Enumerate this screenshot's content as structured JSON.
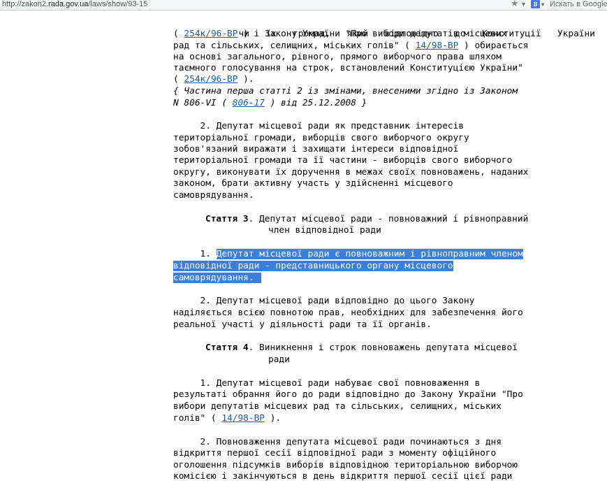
{
  "browser": {
    "url_prefix": "http://zakon2.",
    "url_host": "rada.gov.ua",
    "url_path": "/laws/show/93-15",
    "star_glyph": "★",
    "dropdown_glyph": "▼",
    "search_engine_badge": "8",
    "search_placeholder": "Искать в Google"
  },
  "doc": {
    "l1": [
      "чи",
      "їх",
      "громад,",
      "який",
      "відповідно",
      "до",
      "Конституції",
      "України"
    ],
    "l2_a": "( ",
    "l2_link": "254к/96-ВР",
    "l2_b": " ) і Закону України \"Про вибори депутатів місцевих",
    "l3_a": "рад та сільських, селищних, міських голів\" ( ",
    "l3_link": "14/98-ВР",
    "l3_b": " ) обирається",
    "l4": "на основі загального, рівного, прямого виборчого права шляхом",
    "l5": "таємного голосування на строк, встановлений Конституцією України\"",
    "l6_a": "( ",
    "l6_link": "254к/96-ВР",
    "l6_b": " ).",
    "l7": "{ Частина перша статті 2 із змінами, внесеними згідно із Законом",
    "l8_a": "N 806-VI ( ",
    "l8_link": "806-17",
    "l8_b": " ) від 25.12.2008 }",
    "p2_l1": "     2. Депутат місцевої ради як представник інтересів",
    "p2_l2": "територіальної громади, виборців свого виборчого округу",
    "p2_l3": "зобов'язаний виражати і захищати інтереси відповідної",
    "p2_l4": "територіальної громади та її частини - виборців свого виборчого",
    "p2_l5": "округу, виконувати їх доручення в межах своїх повноважень, наданих",
    "p2_l6": "законом, брати активну участь у здійсненні місцевого",
    "p2_l7": "самоврядування.",
    "art3_label": "Стаття 3",
    "art3_title_1": ". Депутат місцевої ради - повноважний і рівноправний",
    "art3_title_2": "член відповідної ради",
    "a3p1_num": "     1. ",
    "a3p1_l1": "Депутат місцевої ради є повноважним і рівноправним членом",
    "a3p1_l2": "відповідної ради - представницького органу місцевого",
    "a3p1_l3": "самоврядування.",
    "a3p2_l1": "     2. Депутат місцевої ради відповідно до цього Закону",
    "a3p2_l2": "наділяється всією повнотою прав, необхідних для забезпечення його",
    "a3p2_l3": "реальної участі у діяльності ради та її органів.",
    "art4_label": "Стаття 4",
    "art4_title_1": ". Виникнення і строк повноважень депутата місцевої",
    "art4_title_2": "ради",
    "a4p1_l1": "     1. Депутат місцевої ради набуває свої повноваження в",
    "a4p1_l2": "результаті обрання його до ради відповідно до Закону України \"Про",
    "a4p1_l3": "вибори депутатів місцевих рад та сільських, селищних, міських",
    "a4p1_l4_a": "голів\" ( ",
    "a4p1_l4_link": "14/98-ВР",
    "a4p1_l4_b": " ).",
    "a4p2_l1": "     2. Повноваження депутата місцевої ради починаються з дня",
    "a4p2_l2": "відкриття першої сесії відповідної ради з моменту офіційного",
    "a4p2_l3": "оголошення підсумків виборів відповідною територіальною виборчою",
    "a4p2_l4": "комісією і закінчуються в день відкриття першої сесії цієї ради"
  }
}
